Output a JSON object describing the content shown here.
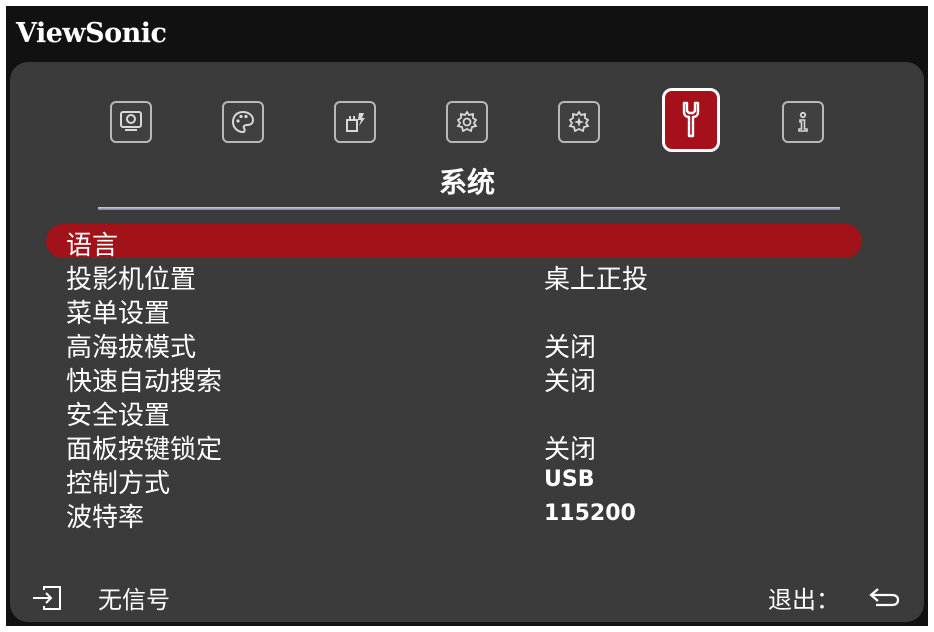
{
  "brand": {
    "name": "ViewSonic"
  },
  "tabs": [
    {
      "icon": "display-icon",
      "active": false
    },
    {
      "icon": "palette-icon",
      "active": false
    },
    {
      "icon": "power-plug-icon",
      "active": false
    },
    {
      "icon": "settings-gear-icon",
      "active": false
    },
    {
      "icon": "advanced-settings-icon",
      "active": false
    },
    {
      "icon": "wrench-icon",
      "active": true
    },
    {
      "icon": "info-icon",
      "active": false
    }
  ],
  "section": {
    "title": "系统"
  },
  "menu": {
    "items": [
      {
        "label": "语言",
        "value": "",
        "selected": true
      },
      {
        "label": "投影机位置",
        "value": "桌上正投",
        "selected": false
      },
      {
        "label": "菜单设置",
        "value": "",
        "selected": false
      },
      {
        "label": "高海拔模式",
        "value": "关闭",
        "selected": false
      },
      {
        "label": "快速自动搜索",
        "value": "关闭",
        "selected": false
      },
      {
        "label": "安全设置",
        "value": "",
        "selected": false
      },
      {
        "label": "面板按键锁定",
        "value": "关闭",
        "selected": false
      },
      {
        "label": "控制方式",
        "value": "USB",
        "selected": false
      },
      {
        "label": "波特率",
        "value": "115200",
        "selected": false
      }
    ]
  },
  "footer": {
    "source_icon": "input-source-icon",
    "source_label": "无信号",
    "exit_label": "退出：",
    "exit_icon": "return-arrow-icon"
  },
  "colors": {
    "highlight": "#a5101a",
    "panel": "#3b3b3b",
    "frame": "#111111",
    "text": "#ffffff"
  }
}
